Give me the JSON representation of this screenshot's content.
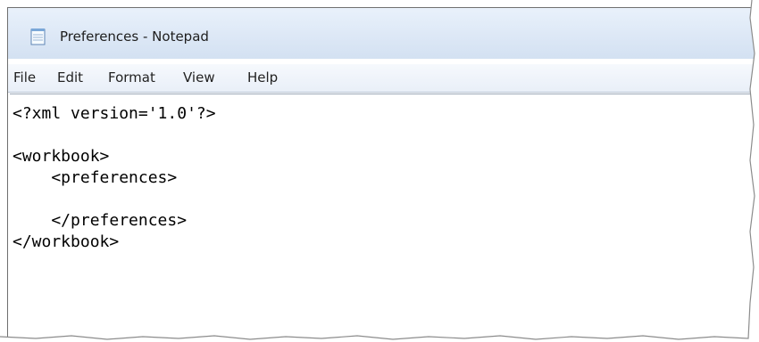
{
  "window": {
    "title": "Preferences - Notepad",
    "icon": "notepad-icon"
  },
  "menu": {
    "items": [
      {
        "label": "File"
      },
      {
        "label": "Edit"
      },
      {
        "label": "Format"
      },
      {
        "label": "View"
      },
      {
        "label": "Help"
      }
    ]
  },
  "editor": {
    "content": "<?xml version='1.0'?>\n\n<workbook>\n    <preferences>\n\n    </preferences>\n</workbook>"
  },
  "colors": {
    "titlebar": "#dde8f6",
    "menubar": "#edf2f9",
    "text": "#000000"
  }
}
